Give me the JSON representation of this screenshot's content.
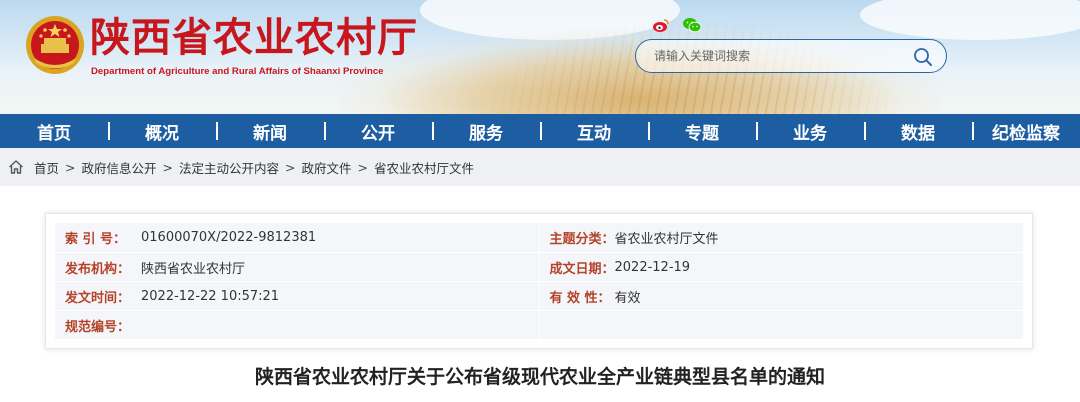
{
  "header": {
    "title": "陕西省农业农村厅",
    "subtitle": "Department of Agriculture and Rural Affairs of Shaanxi Province",
    "search_placeholder": "请输入关键词搜索",
    "brand_color": "#c8161d",
    "nav_color": "#1d5ea3"
  },
  "nav": {
    "items": [
      "首页",
      "概况",
      "新闻",
      "公开",
      "服务",
      "互动",
      "专题",
      "业务",
      "数据",
      "纪检监察"
    ]
  },
  "breadcrumb": {
    "items": [
      "首页",
      "政府信息公开",
      "法定主动公开内容",
      "政府文件",
      "省农业农村厅文件"
    ],
    "separator": ">"
  },
  "meta": {
    "rows": [
      {
        "left_label": "索 引 号：",
        "left_value": "01600070X/2022-9812381",
        "right_label": "主题分类：",
        "right_value": "省农业农村厅文件"
      },
      {
        "left_label": "发布机构：",
        "left_value": "陕西省农业农村厅",
        "right_label": "成文日期：",
        "right_value": "2022-12-19"
      },
      {
        "left_label": "发文时间：",
        "left_value": "2022-12-22 10:57:21",
        "right_label": "有 效 性：",
        "right_value": "有效"
      },
      {
        "left_label": "规范编号：",
        "left_value": "",
        "right_label": "",
        "right_value": ""
      }
    ]
  },
  "document": {
    "title": "陕西省农业农村厅关于公布省级现代农业全产业链典型县名单的通知"
  }
}
